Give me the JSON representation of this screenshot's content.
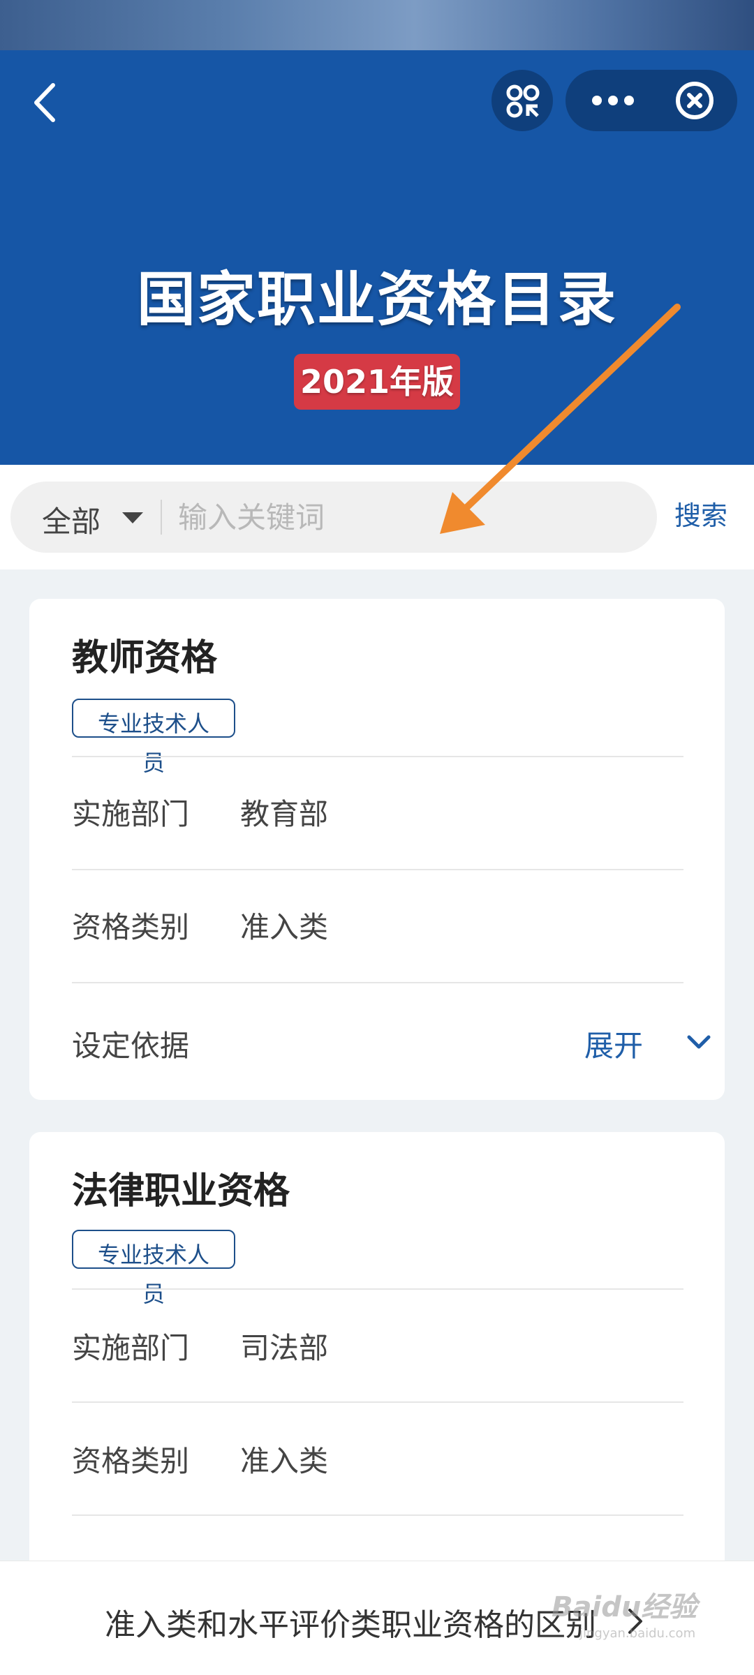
{
  "header": {
    "title": "国家职业资格目录",
    "edition": "2021年版",
    "colors": {
      "background": "#1656a6",
      "badge": "#d53a45"
    },
    "icons": [
      "back-arrow-icon",
      "scan-icon",
      "more-icon",
      "close-circle-icon"
    ]
  },
  "search": {
    "category": "全部",
    "placeholder": "输入关键词",
    "button_label": "搜索"
  },
  "cards": [
    {
      "title": "教师资格",
      "tag": "专业技术人员",
      "rows": [
        {
          "label": "实施部门",
          "value": "教育部"
        },
        {
          "label": "资格类别",
          "value": "准入类"
        }
      ],
      "basis_label": "设定依据",
      "expand_label": "展开"
    },
    {
      "title": "法律职业资格",
      "tag": "专业技术人员",
      "rows": [
        {
          "label": "实施部门",
          "value": "司法部"
        },
        {
          "label": "资格类别",
          "value": "准入类"
        }
      ]
    }
  ],
  "bottom_link": "准入类和水平评价类职业资格的区别",
  "watermark": {
    "brand": "Baidu经验",
    "url": "jingyan.baidu.com"
  }
}
